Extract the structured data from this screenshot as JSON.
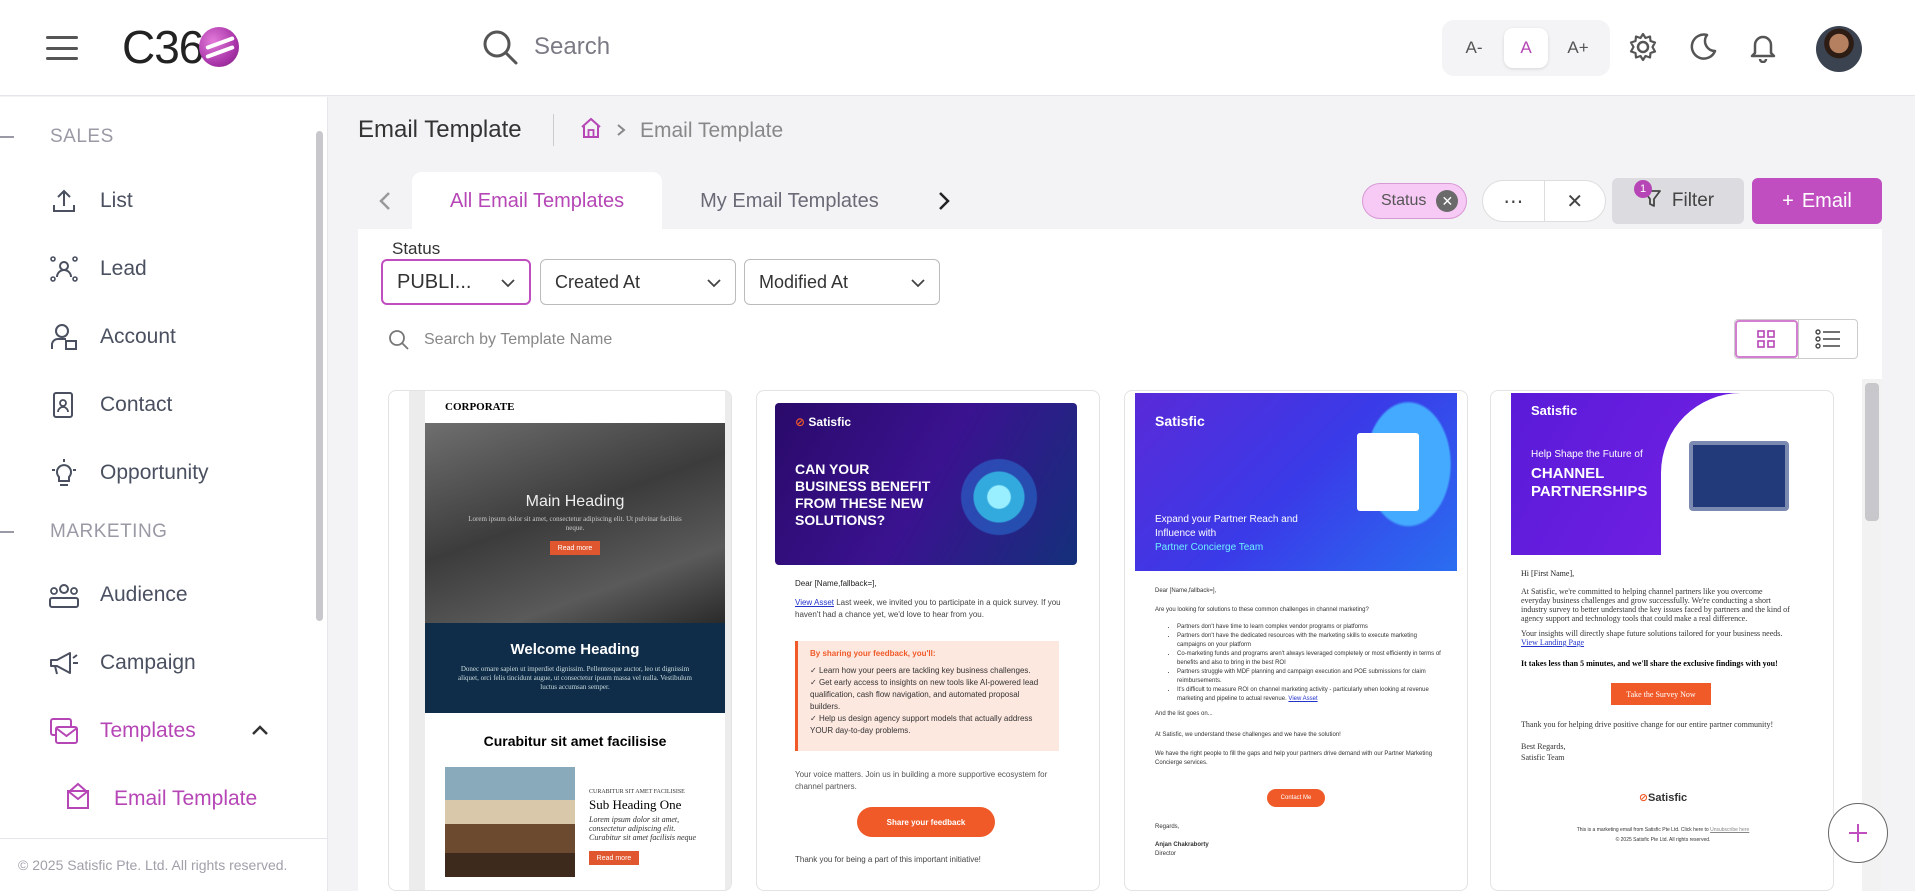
{
  "header": {
    "logo_text": "C36",
    "search_placeholder": "Search",
    "font_sizes": [
      "A-",
      "A",
      "A+"
    ],
    "active_font_size": "A"
  },
  "sidebar": {
    "sections": [
      {
        "label": "SALES",
        "items": [
          "List",
          "Lead",
          "Account",
          "Contact",
          "Opportunity"
        ]
      },
      {
        "label": "MARKETING",
        "items": [
          "Audience",
          "Campaign",
          "Templates"
        ]
      }
    ],
    "active_item": "Templates",
    "sub_item": "Email Template",
    "footer": "© 2025 Satisfic Pte. Ltd. All rights reserved."
  },
  "page": {
    "title": "Email Template",
    "breadcrumb_current": "Email Template"
  },
  "tabs": [
    {
      "label": "All Email Templates",
      "active": true
    },
    {
      "label": "My Email Templates",
      "active": false
    }
  ],
  "filters": {
    "chip_label": "Status",
    "filter_label": "Filter",
    "filter_count": "1",
    "new_label": "Email",
    "status_label": "Status",
    "status_value": "PUBLI...",
    "created_label": "Created At",
    "modified_label": "Modified At",
    "search_placeholder": "Search by Template Name"
  },
  "cards": {
    "c1": {
      "corporate": "CORPORATE",
      "main_heading": "Main Heading",
      "hero_text": "Lorem ipsum dolor sit amet, consectetur adipiscing elit. Ut pulvinar facilisis neque.",
      "read_more": "Read more",
      "welcome": "Welcome Heading",
      "welcome_text": "Donec ornare sapien ut imperdiet dignissim. Pellentesque auctor, leo ut dignissim aliquet, orci felis tincidunt augue, ut consectetur ipsum massa vel nulla. Vestibulum luctus accumsan semper.",
      "curabitur": "Curabitur sit amet facilisise",
      "curabitur_small": "CURABITUR SIT AMET FACILISISE",
      "sub_heading": "Sub Heading One",
      "sub_text": "Lorem ipsum dolor sit amet, consectetur adipiscing elit. Curabitur sit amet facilisis neque",
      "read_more_2": "Read more"
    },
    "c2": {
      "brand": "Satisfic",
      "headline": "CAN YOUR BUSINESS BENEFIT FROM THESE NEW SOLUTIONS?",
      "dear": "Dear [Name,fallback=],",
      "view_asset": "View Asset",
      "intro": " Last week, we invited you to participate in a quick survey. If you haven't had a chance yet, we'd love to hear from you.",
      "box_title": "By sharing your feedback, you'll:",
      "bullets": [
        "Learn how your peers are tackling key business challenges.",
        "Get early access to insights on new tools like AI-powered lead qualification, cash flow navigation, and automated proposal builders.",
        "Help us design agency support models that actually address YOUR day-to-day problems."
      ],
      "voice": "Your voice matters. Join us in building a more supportive ecosystem for channel partners.",
      "share": "Share your feedback",
      "thanks": "Thank you for being a part of this important initiative!"
    },
    "c3": {
      "brand": "Satisfic",
      "headline_1": "Expand your Partner Reach and Influence with",
      "headline_2": "Partner Concierge Team",
      "dear": "Dear [Name,fallback=],",
      "question": "Are you looking for solutions to these common challenges in channel marketing?",
      "bullets": [
        "Partners don't have time to learn complex vendor programs or platforms",
        "Partners don't have the dedicated resources with the marketing skills to execute marketing campaigns on your platform",
        "Co-marketing funds and programs aren't always leveraged completely or most efficiently in terms of benefits and also to bring in the best ROI",
        "Partners struggle with MDF planning and campaign execution and POE submissions for claim reimbursements.",
        "It's difficult to measure ROI on channel marketing activity - particularly when looking at revenue marketing and pipeline to actual revenue."
      ],
      "view_asset": "View Asset",
      "list_goes_on": "And the list goes on...",
      "understand": "At Satisfic, we understand these challenges and we have the solution!",
      "right_people": "We have the right people to fill the gaps and help your partners drive demand with our Partner Marketing Concierge services.",
      "cta": "Contact Me",
      "regards": "Regards,",
      "name": "Anjan Chakraborty",
      "role": "Director"
    },
    "c4": {
      "brand": "Satisfic",
      "sub": "Help Shape the Future of",
      "headline": "CHANNEL PARTNERSHIPS",
      "greet": "Hi [First Name],",
      "p1": "At Satisfic, we're committed to helping channel partners like you overcome everyday business challenges and grow successfully. We're conducting a short industry survey to better understand the key issues faced by partners and the kind of agency support and technology tools that could make a real difference.",
      "p2": "Your insights will directly shape future solutions tailored for your business needs.",
      "link": "View Landing Page",
      "bold": "It takes less than 5 minutes, and we'll share the exclusive findings with you!",
      "cta": "Take the Survey Now",
      "thanks": "Thank you for helping drive positive change for our entire partner community!",
      "regards": "Best Regards,",
      "team": "Satisfic Team",
      "foot_logo": "Satisfic",
      "foot_1": "This is a marketing email from Satisfic Pte Ltd. Click here to",
      "foot_unsub": "Unsubscribe here",
      "foot_2": "© 2025 Satisfic Pte Ltd. All rights reserved."
    }
  },
  "colors": {
    "accent": "#b646b6",
    "primary_button": "#c04ec0",
    "chip": "#f7c9f5",
    "orange": "#f05a28"
  }
}
